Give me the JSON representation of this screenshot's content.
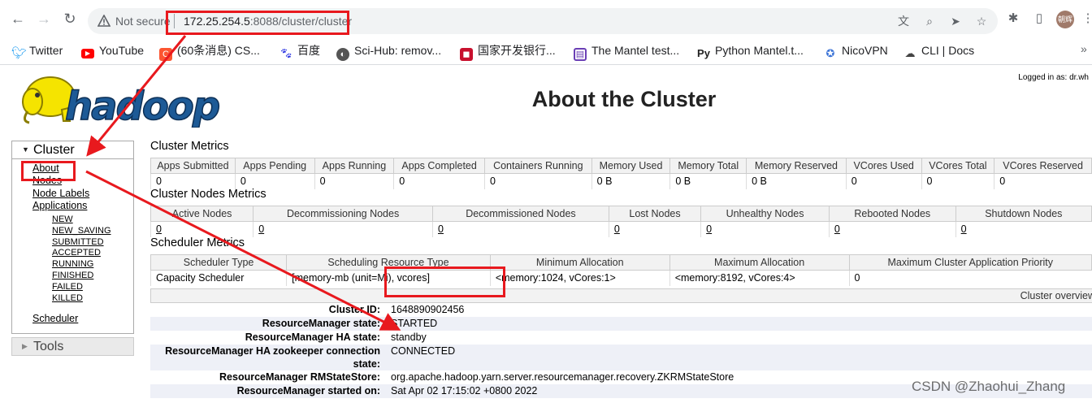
{
  "browser": {
    "security_label": "Not secure",
    "url_host": "172.25.254.5",
    "url_rest": ":8088/cluster/cluster",
    "profile_initials": "朝辉",
    "bookmarks": [
      {
        "label": "Twitter",
        "icon": "twitter-icon",
        "color": "#1d9bf0"
      },
      {
        "label": "YouTube",
        "icon": "youtube-icon",
        "color": "#ff0000"
      },
      {
        "label": "(60条消息) CS...",
        "icon": "csdn-icon",
        "color": "#fc5531"
      },
      {
        "label": "百度",
        "icon": "baidu-icon",
        "color": "#2932e1"
      },
      {
        "label": "Sci-Hub: remov...",
        "icon": "scihub-icon",
        "color": "#555555"
      },
      {
        "label": "国家开发银行...",
        "icon": "cdb-icon",
        "color": "#c8102e"
      },
      {
        "label": "The Mantel test...",
        "icon": "mantel-icon",
        "color": "#6a3fb5"
      },
      {
        "label": "Python Mantel.t...",
        "icon": "pypi-icon",
        "color": "#222222"
      },
      {
        "label": "NicoVPN",
        "icon": "nicovpn-icon",
        "color": "#3b73d6"
      },
      {
        "label": "CLI | Docs",
        "icon": "cloud-icon",
        "color": "#444444"
      }
    ]
  },
  "page": {
    "logged_in": "Logged in as: dr.wh",
    "title": "About the Cluster"
  },
  "sidebar": {
    "cluster_label": "Cluster",
    "links": [
      "About",
      "Nodes",
      "Node Labels",
      "Applications"
    ],
    "app_states": [
      "NEW",
      "NEW_SAVING",
      "SUBMITTED",
      "ACCEPTED",
      "RUNNING",
      "FINISHED",
      "FAILED",
      "KILLED"
    ],
    "scheduler": "Scheduler",
    "tools_label": "Tools"
  },
  "cluster_metrics": {
    "title": "Cluster Metrics",
    "headers": [
      "Apps Submitted",
      "Apps Pending",
      "Apps Running",
      "Apps Completed",
      "Containers Running",
      "Memory Used",
      "Memory Total",
      "Memory Reserved",
      "VCores Used",
      "VCores Total",
      "VCores Reserved"
    ],
    "values": [
      "0",
      "0",
      "0",
      "0",
      "0",
      "0 B",
      "0 B",
      "0 B",
      "0",
      "0",
      "0"
    ]
  },
  "node_metrics": {
    "title": "Cluster Nodes Metrics",
    "headers": [
      "Active Nodes",
      "Decommissioning Nodes",
      "Decommissioned Nodes",
      "Lost Nodes",
      "Unhealthy Nodes",
      "Rebooted Nodes",
      "Shutdown Nodes"
    ],
    "values": [
      "0",
      "0",
      "0",
      "0",
      "0",
      "0",
      "0"
    ]
  },
  "scheduler_metrics": {
    "title": "Scheduler Metrics",
    "headers": [
      "Scheduler Type",
      "Scheduling Resource Type",
      "Minimum Allocation",
      "Maximum Allocation",
      "Maximum Cluster Application Priority"
    ],
    "values": [
      "Capacity Scheduler",
      "[memory-mb (unit=Mi), vcores]",
      "<memory:1024, vCores:1>",
      "<memory:8192, vCores:4>",
      "0"
    ]
  },
  "overview": {
    "header": "Cluster overview",
    "rows": [
      {
        "key": "Cluster ID:",
        "value": "1648890902456"
      },
      {
        "key": "ResourceManager state:",
        "value": "STARTED"
      },
      {
        "key": "ResourceManager HA state:",
        "value": "standby"
      },
      {
        "key": "ResourceManager HA zookeeper connection state:",
        "value": "CONNECTED"
      },
      {
        "key": "ResourceManager RMStateStore:",
        "value": "org.apache.hadoop.yarn.server.resourcemanager.recovery.ZKRMStateStore"
      },
      {
        "key": "ResourceManager started on:",
        "value": "Sat Apr 02 17:15:02 +0800 2022"
      }
    ]
  },
  "watermark": "CSDN @Zhaohui_Zhang",
  "colors": {
    "annotation_red": "#e8191e",
    "logo_yellow": "#f5e400",
    "logo_blue": "#1d5a96"
  }
}
